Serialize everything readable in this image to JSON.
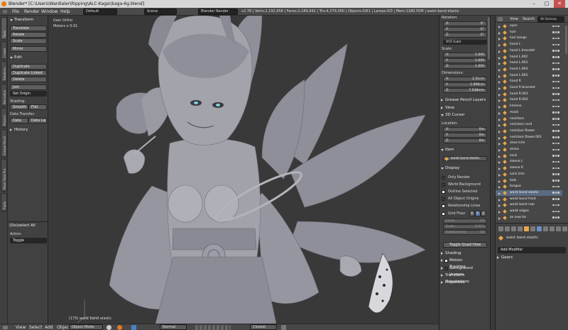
{
  "window": {
    "title": "Blender* [C:\\Users\\Wardialer\\Ripping\\ALC-Kaga\\\\kaga-6g.blend]",
    "controls": [
      "–",
      "□",
      "✕"
    ]
  },
  "menubar": {
    "items": [
      "File",
      "Render",
      "Window",
      "Help"
    ],
    "layout": "Default",
    "scene": "Scene",
    "engine": "Blender Render",
    "stats": "v2.78 | Verts:2,192,958 | Faces:2,189,942 | Tris:4,379,360 | Objects:0/61 | Lamps:0/0 | Mem:1180.55M | waist band elastic"
  },
  "left_tabs": [
    "Tools",
    "Create",
    "Relations",
    "Animation",
    "Physics",
    "Grease Pencil",
    "Mesh Tools Pro",
    "Rigify"
  ],
  "toolshelf": {
    "transform_header": "Transform",
    "transform_buttons": [
      "Translate",
      "Rotate",
      "Scale",
      "Mirror"
    ],
    "edit_header": "Edit",
    "edit_buttons": [
      "Duplicate",
      "Duplicate Linked",
      "Delete",
      "Join"
    ],
    "set_origin": "Set Origin",
    "shading_label": "Shading:",
    "smooth": "Smooth",
    "flat": "Flat",
    "data_transfer_label": "Data Transfer:",
    "data": "Data",
    "data_layout": "Data Layo",
    "history_header": "History",
    "operator_title": "(De)select All",
    "action_label": "Action",
    "action_value": "Toggle"
  },
  "viewport": {
    "view_name": "User Ortho",
    "scale_text": "Meters x 0.01",
    "object_label": "(175) waist band elastic",
    "background_color": "#393939",
    "mesh_color": "#9b9ba4"
  },
  "viewport_header": {
    "items": [
      "View",
      "Select",
      "Add",
      "Object"
    ],
    "mode": "Object Mode",
    "shading": "Normal",
    "snap": "Closest"
  },
  "npanel": {
    "rotation_label": "Rotation:",
    "rotation": [
      {
        "axis": "X:",
        "value": "0°"
      },
      {
        "axis": "Y:",
        "value": "0°"
      },
      {
        "axis": "Z:",
        "value": "0°"
      }
    ],
    "rotation_mode": "XYZ Euler",
    "scale_label": "Scale:",
    "scale": [
      {
        "axis": "X:",
        "value": "1.000"
      },
      {
        "axis": "Y:",
        "value": "1.000"
      },
      {
        "axis": "Z:",
        "value": "1.000"
      }
    ],
    "dimensions_label": "Dimensions:",
    "dimensions": [
      {
        "axis": "X:",
        "value": "2.31cm"
      },
      {
        "axis": "Y:",
        "value": "1.996cm"
      },
      {
        "axis": "Z:",
        "value": "7.638mm"
      }
    ],
    "grease_pencil": "Grease Pencil Layers",
    "view": "View",
    "cursor_header": "3D Cursor",
    "location_label": "Location:",
    "location": [
      {
        "axis": "X:",
        "value": "0m"
      },
      {
        "axis": "Y:",
        "value": "0m"
      },
      {
        "axis": "Z:",
        "value": "0m"
      }
    ],
    "item_header": "Item",
    "item_name": "waist band elastic",
    "display_header": "Display",
    "display_checks": [
      {
        "label": "Only Render",
        "checked": false
      },
      {
        "label": "World Background",
        "checked": false
      },
      {
        "label": "Outline Selected",
        "checked": true
      },
      {
        "label": "All Object Origins",
        "checked": false
      },
      {
        "label": "Relationship Lines",
        "checked": true
      }
    ],
    "grid_floor": "Grid Floor",
    "grid_axes": [
      "X",
      "Y",
      "Z"
    ],
    "grid_fields": [
      {
        "label": "Lines:",
        "value": "16"
      },
      {
        "label": "Scale:",
        "value": "0.010"
      },
      {
        "label": "Subdivisions:",
        "value": "10"
      }
    ],
    "toggle_quad": "Toggle Quad View",
    "bottom_panels": [
      "Shading",
      "Motion Tracking",
      "Background Images",
      "Transform Orientations",
      "Properties"
    ]
  },
  "outliner": {
    "tabs": [
      "View",
      "Search",
      "All Scenes"
    ],
    "items": [
      "eyes",
      "hair",
      "hair bangs",
      "hand L",
      "hand L bracelet",
      "hand L.002",
      "hand L.003",
      "hand L.004",
      "hand L.005",
      "hand R",
      "hand R bracelet",
      "hand R.001",
      "hand R.002",
      "kimono",
      "mask",
      "necklace",
      "necklace cord",
      "necklace flower",
      "necklace flower.001",
      "shoe trim",
      "shoes",
      "sock",
      "sleeve L",
      "sleeve R",
      "sock trim",
      "tails",
      "tongue",
      "waist band elastic",
      "waist band front",
      "waist band rear",
      "waist edges",
      "ze new tie"
    ],
    "selected_index": 27
  },
  "properties": {
    "object_name": "waist band elastic",
    "add_modifier": "Add Modifier",
    "gears_label": "Gears"
  }
}
